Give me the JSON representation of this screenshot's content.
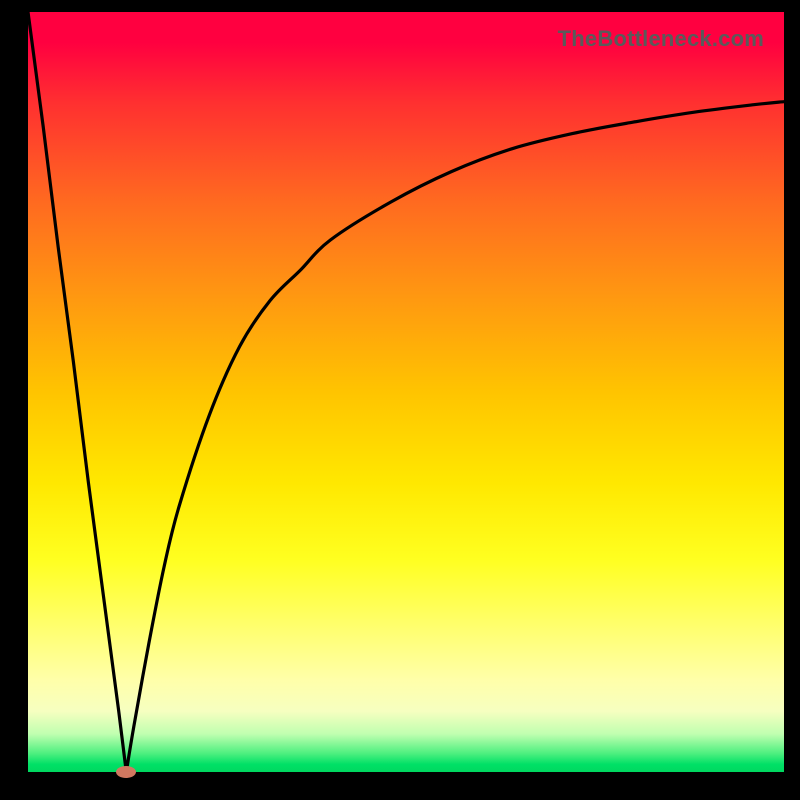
{
  "watermark": "TheBottleneck.com",
  "colors": {
    "frame": "#000000",
    "curve": "#000000",
    "marker": "#d07860"
  },
  "chart_data": {
    "type": "line",
    "title": "",
    "xlabel": "",
    "ylabel": "",
    "xlim": [
      0,
      100
    ],
    "ylim": [
      0,
      100
    ],
    "grid": false,
    "legend": false,
    "annotations": [],
    "curve_description": "V-shaped bottleneck curve: steep linear descent from top-left to a minimum near x≈13, then asymptotic rise toward ~88 at the right edge",
    "minimum_point": {
      "x": 13,
      "y": 0
    },
    "x": [
      0,
      2,
      4,
      6,
      8,
      10,
      12,
      13,
      14,
      16,
      18,
      20,
      24,
      28,
      32,
      36,
      40,
      48,
      56,
      64,
      72,
      80,
      88,
      96,
      100
    ],
    "values": [
      100,
      85,
      69,
      54,
      38,
      23,
      8,
      0,
      6,
      17,
      27,
      35,
      47,
      56,
      62,
      66,
      70,
      75,
      79,
      82,
      84,
      85.5,
      86.8,
      87.8,
      88.2
    ],
    "background_gradient": "vertical red→orange→yellow→green"
  }
}
